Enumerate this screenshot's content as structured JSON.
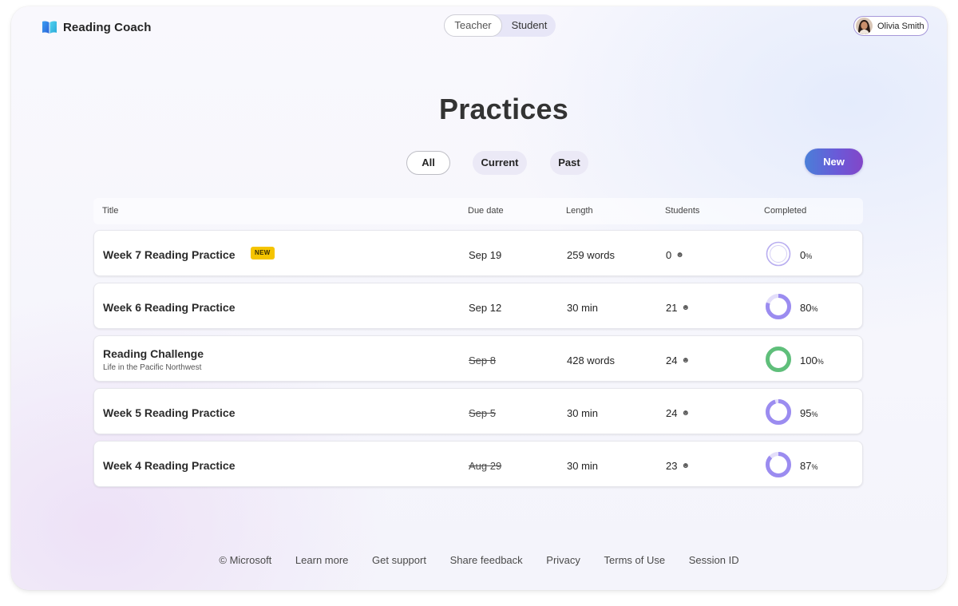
{
  "header": {
    "app_name": "Reading Coach",
    "roles": [
      "Teacher",
      "Student"
    ],
    "user_name": "Olivia Smith"
  },
  "page": {
    "title": "Practices"
  },
  "filters": [
    "All",
    "Current",
    "Past"
  ],
  "new_button_label": "New",
  "table": {
    "columns": [
      "Title",
      "Due date",
      "Length",
      "Students",
      "Completed"
    ],
    "rows": [
      {
        "title": "Week 7 Reading Practice",
        "badge": "NEW",
        "subtitle": "",
        "due": "Sep 19",
        "due_past": false,
        "length": "259 words",
        "students": "0",
        "completed": 0
      },
      {
        "title": "Week 6 Reading Practice",
        "badge": "",
        "subtitle": "",
        "due": "Sep 12",
        "due_past": false,
        "length": "30 min",
        "students": "21",
        "completed": 80
      },
      {
        "title": "Reading Challenge",
        "badge": "",
        "subtitle": "Life in the Pacific Northwest",
        "due": "Sep 8",
        "due_past": true,
        "length": "428 words",
        "students": "24",
        "completed": 100
      },
      {
        "title": "Week 5 Reading Practice",
        "badge": "",
        "subtitle": "",
        "due": "Sep 5",
        "due_past": true,
        "length": "30 min",
        "students": "24",
        "completed": 95
      },
      {
        "title": "Week 4 Reading Practice",
        "badge": "",
        "subtitle": "",
        "due": "Aug 29",
        "due_past": true,
        "length": "30 min",
        "students": "23",
        "completed": 87
      }
    ]
  },
  "percent_sign": "%",
  "icons": {
    "brand": "book-icon",
    "students": "person-icon",
    "progress": "progress-ring-icon"
  },
  "colors": {
    "progress_purple": "#9b8cf0",
    "progress_track": "#e3defa",
    "progress_complete": "#5fbf7a",
    "new_badge": "#f5c400",
    "accent_gradient_start": "#4a7fd8",
    "accent_gradient_end": "#8346c8"
  },
  "footer": {
    "links": [
      "© Microsoft",
      "Learn more",
      "Get support",
      "Share feedback",
      "Privacy",
      "Terms of Use",
      "Session ID"
    ]
  }
}
